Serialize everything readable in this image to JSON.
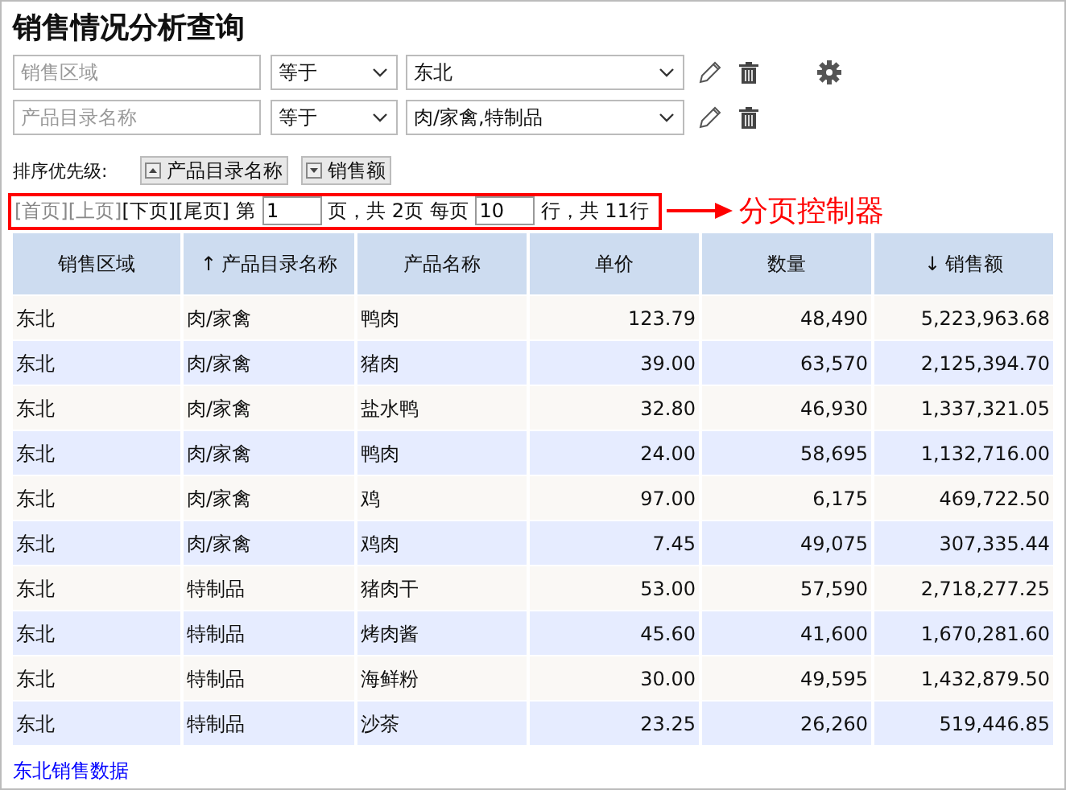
{
  "title": "销售情况分析查询",
  "filters": [
    {
      "field_placeholder": "销售区域",
      "operator": "等于",
      "value": "东北",
      "settings": true
    },
    {
      "field_placeholder": "产品目录名称",
      "operator": "等于",
      "value": "肉/家禽,特制品",
      "settings": false
    }
  ],
  "sort": {
    "label": "排序优先级:",
    "items": [
      {
        "label": "产品目录名称",
        "kind": "ascending"
      },
      {
        "label": "销售额",
        "kind": "descending"
      }
    ]
  },
  "pager": {
    "links": [
      {
        "label": "[首页]",
        "disabled": true
      },
      {
        "label": "[上页]",
        "disabled": true
      },
      {
        "label": "[下页]",
        "disabled": false
      },
      {
        "label": "[尾页]",
        "disabled": false
      }
    ],
    "page_prefix": "第",
    "page": "1",
    "page_suffix": "页，共 2页 每页",
    "page_size": "10",
    "rows_suffix": "行，共 11行"
  },
  "annotation": {
    "label": "分页控制器"
  },
  "table": {
    "columns": [
      {
        "label": "销售区域",
        "kind": "text"
      },
      {
        "label": "产品目录名称",
        "arrow": "↑",
        "kind": "text"
      },
      {
        "label": "产品名称",
        "kind": "text"
      },
      {
        "label": "单价",
        "kind": "number"
      },
      {
        "label": "数量",
        "kind": "number"
      },
      {
        "label": "销售额",
        "arrow": "↓",
        "kind": "number"
      }
    ],
    "rows": [
      [
        "东北",
        "肉/家禽",
        "鸭肉",
        "123.79",
        "48,490",
        "5,223,963.68"
      ],
      [
        "东北",
        "肉/家禽",
        "猪肉",
        "39.00",
        "63,570",
        "2,125,394.70"
      ],
      [
        "东北",
        "肉/家禽",
        "盐水鸭",
        "32.80",
        "46,930",
        "1,337,321.05"
      ],
      [
        "东北",
        "肉/家禽",
        "鸭肉",
        "24.00",
        "58,695",
        "1,132,716.00"
      ],
      [
        "东北",
        "肉/家禽",
        "鸡",
        "97.00",
        "6,175",
        "469,722.50"
      ],
      [
        "东北",
        "肉/家禽",
        "鸡肉",
        "7.45",
        "49,075",
        "307,335.44"
      ],
      [
        "东北",
        "特制品",
        "猪肉干",
        "53.00",
        "57,590",
        "2,718,277.25"
      ],
      [
        "东北",
        "特制品",
        "烤肉酱",
        "45.60",
        "41,600",
        "1,670,281.60"
      ],
      [
        "东北",
        "特制品",
        "海鲜粉",
        "30.00",
        "49,595",
        "1,432,879.50"
      ],
      [
        "东北",
        "特制品",
        "沙茶",
        "23.25",
        "26,260",
        "519,446.85"
      ]
    ]
  },
  "footer_link": "东北销售数据"
}
